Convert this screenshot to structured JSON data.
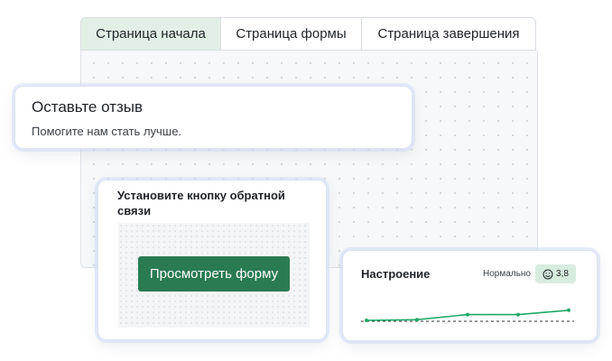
{
  "tabs": [
    {
      "label": "Страница начала",
      "active": true
    },
    {
      "label": "Страница формы",
      "active": false
    },
    {
      "label": "Страница завершения",
      "active": false
    }
  ],
  "feedback_card": {
    "title": "Оставьте отзыв",
    "subtitle": "Помогите нам стать лучше."
  },
  "install_card": {
    "title": "Установите кнопку обратной связи",
    "button_label": "Просмотреть форму"
  },
  "mood_card": {
    "title": "Настроение",
    "status": "Нормально",
    "score": "3,8",
    "badge_icon": "smiley-face-icon"
  },
  "colors": {
    "accent": "#2a7b52",
    "chart_line": "#1fa86a",
    "badge_bg": "#d7ecdf",
    "active_tab_bg": "#e2efe6"
  },
  "chart_data": {
    "type": "line",
    "series": [
      {
        "values": [
          1,
          1.2,
          2.6,
          2.6,
          3.8
        ]
      }
    ],
    "baseline": 1,
    "ylim": [
      0,
      5
    ],
    "grid": false,
    "xlabel": "",
    "ylabel": ""
  }
}
